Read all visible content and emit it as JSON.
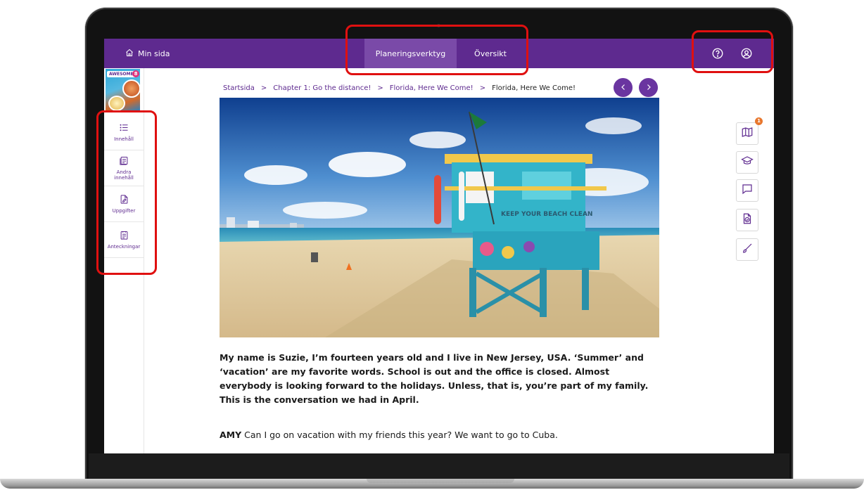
{
  "topbar": {
    "home_label": "Min sida",
    "tabs": [
      {
        "label": "Planeringsverktyg",
        "active": true
      },
      {
        "label": "Översikt",
        "active": false
      }
    ],
    "icons": [
      "help-icon",
      "user-icon"
    ]
  },
  "book": {
    "logo": "AWESOME",
    "grade": "8"
  },
  "sidebar": {
    "items": [
      {
        "label": "Innehåll",
        "icon": "list-icon"
      },
      {
        "label": "Andra innehåll",
        "icon": "stack-icon"
      },
      {
        "label": "Uppgifter",
        "icon": "task-icon"
      },
      {
        "label": "Anteckningar",
        "icon": "notes-icon"
      }
    ]
  },
  "breadcrumb": {
    "items": [
      "Startsida",
      "Chapter 1: Go the distance!",
      "Florida, Here We Come!",
      "Florida, Here We Come!"
    ]
  },
  "content": {
    "intro": "My name is Suzie, I’m fourteen years old and I live in New Jersey, USA. ‘Summer’ and ‘vacation’ are my favorite words. School is out and the office is closed. Almost everybody is looking forward to the holidays. Unless, that is, you’re part of my family. This is the conversation we had in April.",
    "dialogue_speaker": "AMY",
    "dialogue_text": "Can I go on vacation with my friends this year? We want to go to Cuba.",
    "hero_sign_text": "KEEP YOUR BEACH CLEAN"
  },
  "tools": {
    "items": [
      "map-icon",
      "graduation-cap-icon",
      "chat-icon",
      "check-document-icon",
      "brush-icon"
    ],
    "badge_count": "1"
  },
  "colors": {
    "brand_purple": "#5e2a8f",
    "active_tab": "#7a4aa8",
    "highlight_red": "#e01010",
    "badge_orange": "#e8772e"
  }
}
